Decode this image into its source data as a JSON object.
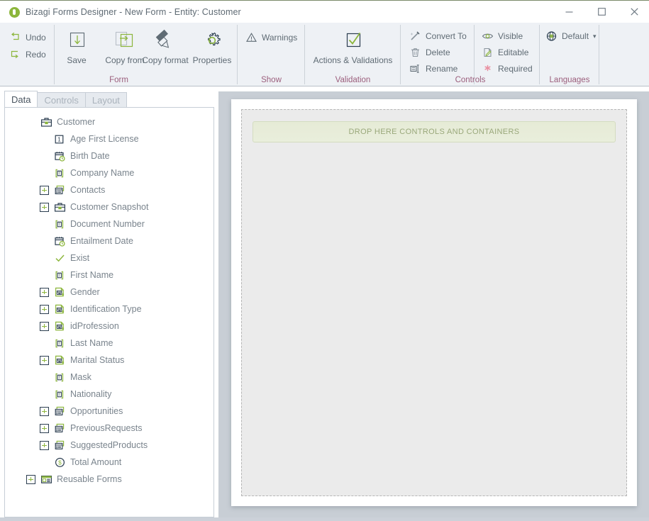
{
  "window": {
    "title": "Bizagi Forms Designer  - New Form - Entity:  Customer",
    "logo_icon": "bizagi-logo-icon",
    "minimize_icon": "minimize-icon",
    "maximize_icon": "maximize-icon",
    "close_icon": "close-icon"
  },
  "ribbon": {
    "groups": [
      {
        "name": "Form",
        "label": "Form"
      },
      {
        "name": "Show",
        "label": "Show"
      },
      {
        "name": "Validation",
        "label": "Validation"
      },
      {
        "name": "Controls",
        "label": "Controls"
      },
      {
        "name": "Languages",
        "label": "Languages"
      }
    ],
    "form": {
      "undo": {
        "label": "Undo",
        "icon": "undo-icon"
      },
      "redo": {
        "label": "Redo",
        "icon": "redo-icon"
      },
      "save": {
        "label": "Save",
        "icon": "save-icon"
      },
      "copy_from": {
        "label": "Copy from",
        "icon": "copy-from-icon"
      },
      "copy_format": {
        "label": "Copy format",
        "icon": "copy-format-icon"
      },
      "properties": {
        "label": "Properties",
        "icon": "gear-icon"
      }
    },
    "show": {
      "warnings": {
        "label": "Warnings",
        "icon": "warning-triangle-icon"
      }
    },
    "validation": {
      "actions_validations": {
        "label": "Actions & Validations",
        "icon": "checkmark-box-icon"
      }
    },
    "controls": {
      "convert_to": {
        "label": "Convert To",
        "icon": "convert-wand-icon"
      },
      "delete": {
        "label": "Delete",
        "icon": "trash-icon"
      },
      "rename": {
        "label": "Rename",
        "icon": "rename-icon"
      },
      "visible": {
        "label": "Visible",
        "icon": "eye-icon"
      },
      "editable": {
        "label": "Editable",
        "icon": "editable-pencil-icon"
      },
      "required": {
        "label": "Required",
        "icon": "required-asterisk-icon"
      }
    },
    "languages": {
      "default": {
        "label": "Default",
        "icon": "globe-icon",
        "caret": "▾"
      }
    }
  },
  "left_panel": {
    "tabs": [
      {
        "label": "Data",
        "active": true
      },
      {
        "label": "Controls",
        "active": false
      },
      {
        "label": "Layout",
        "active": false
      }
    ],
    "tree": [
      {
        "label": "Customer",
        "icon": "entity-briefcase-icon",
        "indent": 0,
        "expander": false
      },
      {
        "label": "Age First License",
        "icon": "number-field-icon",
        "indent": 1,
        "expander": false
      },
      {
        "label": "Birth Date",
        "icon": "date-field-icon",
        "indent": 1,
        "expander": false
      },
      {
        "label": "Company Name",
        "icon": "text-field-icon",
        "indent": 1,
        "expander": false
      },
      {
        "label": "Contacts",
        "icon": "collection-icon",
        "indent": 1,
        "expander": true
      },
      {
        "label": "Customer Snapshot",
        "icon": "entity-briefcase-icon",
        "indent": 1,
        "expander": true
      },
      {
        "label": "Document Number",
        "icon": "text-field-icon",
        "indent": 1,
        "expander": false
      },
      {
        "label": "Entailment Date",
        "icon": "date-field-icon",
        "indent": 1,
        "expander": false
      },
      {
        "label": "Exist",
        "icon": "boolean-check-icon",
        "indent": 1,
        "expander": false
      },
      {
        "label": "First Name",
        "icon": "text-field-icon",
        "indent": 1,
        "expander": false
      },
      {
        "label": "Gender",
        "icon": "parameter-entity-icon",
        "indent": 1,
        "expander": true
      },
      {
        "label": "Identification Type",
        "icon": "parameter-entity-icon",
        "indent": 1,
        "expander": true
      },
      {
        "label": "idProfession",
        "icon": "parameter-entity-icon",
        "indent": 1,
        "expander": true
      },
      {
        "label": "Last Name",
        "icon": "text-field-icon",
        "indent": 1,
        "expander": false
      },
      {
        "label": "Marital Status",
        "icon": "parameter-entity-icon",
        "indent": 1,
        "expander": true
      },
      {
        "label": "Mask",
        "icon": "text-field-icon",
        "indent": 1,
        "expander": false
      },
      {
        "label": "Nationality",
        "icon": "text-field-icon",
        "indent": 1,
        "expander": false
      },
      {
        "label": "Opportunities",
        "icon": "collection-icon",
        "indent": 1,
        "expander": true
      },
      {
        "label": "PreviousRequests",
        "icon": "collection-icon",
        "indent": 1,
        "expander": true
      },
      {
        "label": "SuggestedProducts",
        "icon": "collection-icon",
        "indent": 1,
        "expander": true
      },
      {
        "label": "Total Amount",
        "icon": "currency-icon",
        "indent": 1,
        "expander": false
      },
      {
        "label": "Reusable Forms",
        "icon": "reusable-forms-icon",
        "indent": 0,
        "expander": true
      }
    ]
  },
  "canvas": {
    "dropzone_text": "DROP HERE CONTROLS AND CONTAINERS"
  },
  "colors": {
    "accent_green": "#8cb63c",
    "group_label": "#9b5e7c",
    "icon_dark": "#2c3e50",
    "text": "#5f6b74",
    "tree_text": "#7a848d",
    "dropzone_text": "#9aa87b",
    "canvas_back": "#c8ced5"
  }
}
